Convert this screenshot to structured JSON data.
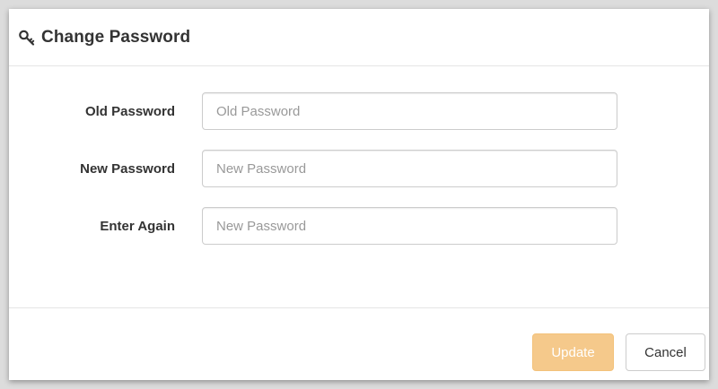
{
  "dialog": {
    "title": "Change Password",
    "icon": "key-icon"
  },
  "form": {
    "fields": [
      {
        "label": "Old Password",
        "placeholder": "Old Password",
        "value": ""
      },
      {
        "label": "New Password",
        "placeholder": "New Password",
        "value": ""
      },
      {
        "label": "Enter Again",
        "placeholder": "New Password",
        "value": ""
      }
    ]
  },
  "footer": {
    "update_label": "Update",
    "cancel_label": "Cancel"
  },
  "colors": {
    "update_button": "#f0ad4e",
    "text": "#333333",
    "border": "#cccccc"
  }
}
